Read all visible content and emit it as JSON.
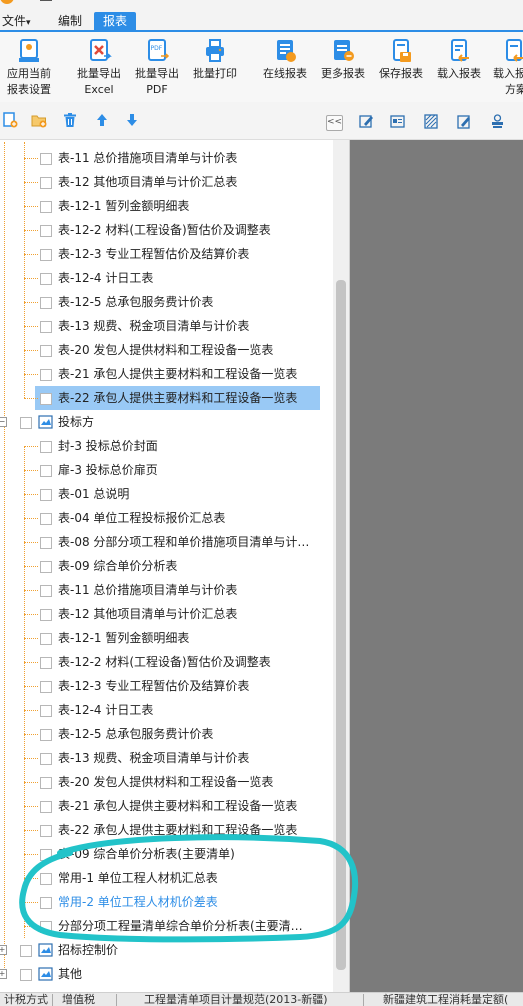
{
  "menubar": {
    "file_label": "文件",
    "file_arrow": "▾",
    "edit_label": "编制",
    "report_tab": "报表"
  },
  "toolbar": {
    "buttons": [
      {
        "label1": "应用当前",
        "label2": "报表设置",
        "icon": "apply-settings-icon"
      },
      {
        "label1": "批量导出",
        "label2": "Excel",
        "icon": "excel-export-icon"
      },
      {
        "label1": "批量导出",
        "label2": "PDF",
        "icon": "pdf-export-icon"
      },
      {
        "label1": "批量打印",
        "label2": "",
        "icon": "print-icon"
      },
      {
        "label1": "在线报表",
        "label2": "",
        "icon": "online-report-icon"
      },
      {
        "label1": "更多报表",
        "label2": "",
        "icon": "more-reports-icon"
      },
      {
        "label1": "保存报表",
        "label2": "",
        "icon": "save-report-icon"
      },
      {
        "label1": "载入报表",
        "label2": "",
        "icon": "load-report-icon"
      },
      {
        "label1": "载入报",
        "label2": "方案",
        "icon": "load-scheme-icon"
      }
    ]
  },
  "pane_toolbar": {
    "icons": [
      "new-report-icon",
      "new-folder-icon",
      "delete-icon",
      "move-up-icon",
      "move-down-icon"
    ],
    "collapse_label": "<<"
  },
  "right_toolbar": {
    "icons": [
      "edit-icon",
      "card-icon",
      "shade-icon",
      "edit-doc-icon",
      "stamp-icon"
    ]
  },
  "tree": {
    "group1_items": [
      "表-11 总价措施项目清单与计价表",
      "表-12 其他项目清单与计价汇总表",
      "表-12-1 暂列金额明细表",
      "表-12-2 材料(工程设备)暂估价及调整表",
      "表-12-3 专业工程暂估价及结算价表",
      "表-12-4 计日工表",
      "表-12-5 总承包服务费计价表",
      "表-13 规费、税金项目清单与计价表",
      "表-20 发包人提供材料和工程设备一览表",
      "表-21 承包人提供主要材料和工程设备一览表",
      "表-22 承包人提供主要材料和工程设备一览表"
    ],
    "bidder_folder": "投标方",
    "bidder_items": [
      "封-3 投标总价封面",
      "扉-3 投标总价扉页",
      "表-01 总说明",
      "表-04 单位工程投标报价汇总表",
      "表-08 分部分项工程和单价措施项目清单与计…",
      "表-09 综合单价分析表",
      "表-11 总价措施项目清单与计价表",
      "表-12 其他项目清单与计价汇总表",
      "表-12-1 暂列金额明细表",
      "表-12-2 材料(工程设备)暂估价及调整表",
      "表-12-3 专业工程暂估价及结算价表",
      "表-12-4 计日工表",
      "表-12-5 总承包服务费计价表",
      "表-13 规费、税金项目清单与计价表",
      "表-20 发包人提供材料和工程设备一览表",
      "表-21 承包人提供主要材料和工程设备一览表",
      "表-22 承包人提供主要材料和工程设备一览表",
      "表-09 综合单价分析表(主要清单)",
      "常用-1 单位工程人材机汇总表",
      "常用-2 单位工程人材机价差表",
      "分部分项工程量清单综合单价分析表(主要清…"
    ],
    "bid_control_folder": "招标控制价",
    "other_folder": "其他"
  },
  "status_tabs": [
    "计税方式",
    "增值税",
    "工程量清单项目计量规范(2013-新疆)",
    "新疆建筑工程消耗量定额("
  ],
  "colors": {
    "accent": "#2d8de6",
    "selection": "#99c9f5",
    "annotation": "#22c3c9",
    "tree_line": "#f0a030"
  }
}
